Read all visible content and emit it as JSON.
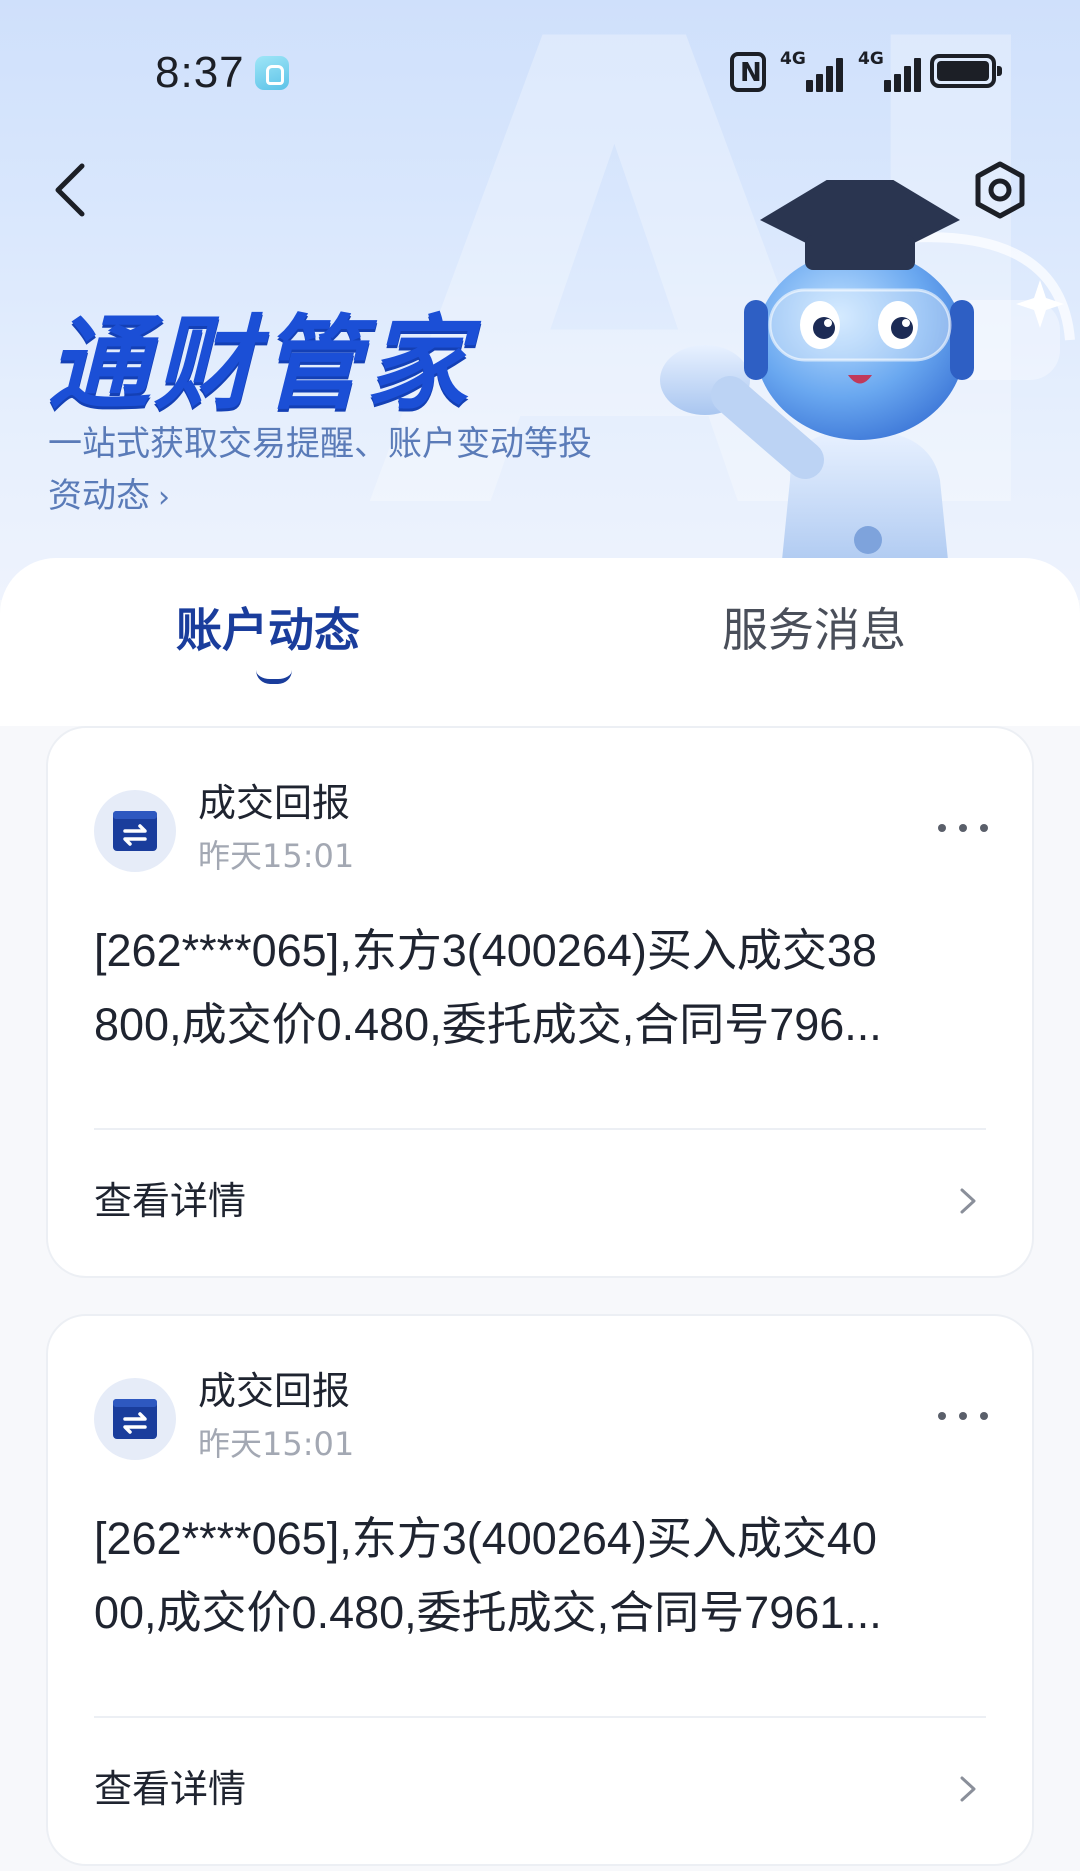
{
  "status_bar": {
    "time": "8:37",
    "nfc_label": "N",
    "sim1_label": "4G",
    "sim2_label": "4G"
  },
  "header": {
    "title": "通财管家",
    "subtitle": "一站式获取交易提醒、账户变动等投资动态",
    "subtitle_chevron": "›",
    "watermark": "AI",
    "back_icon": "chevron-left-icon",
    "settings_icon": "gear-icon"
  },
  "tabs": [
    {
      "label": "账户动态",
      "active": true
    },
    {
      "label": "服务消息",
      "active": false
    }
  ],
  "cards": [
    {
      "title": "成交回报",
      "time": "昨天15:01",
      "line1": "[262****065],东方3(400264)买入成交38",
      "line2": "800,成交价0.480,委托成交,合同号796...",
      "detail_label": "查看详情"
    },
    {
      "title": "成交回报",
      "time": "昨天15:01",
      "line1": "[262****065],东方3(400264)买入成交40",
      "line2": "00,成交价0.480,委托成交,合同号7961...",
      "detail_label": "查看详情"
    }
  ],
  "colors": {
    "brand": "#1b4fd6",
    "tab_active": "#1a3d9c",
    "hero_bg": "#d9e7fd"
  }
}
